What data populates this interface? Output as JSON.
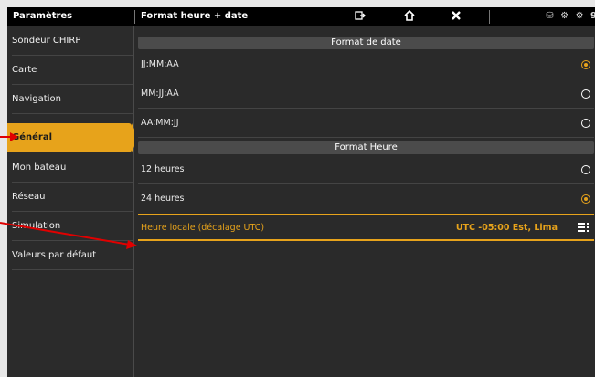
{
  "topbar": {
    "section_title": "Paramètres",
    "page_title": "Format heure + date",
    "icons": [
      "exit-icon",
      "home-icon",
      "close-icon"
    ],
    "status_icons": "⛁ ⚙ ⚙ 9"
  },
  "sidebar": {
    "items": [
      {
        "label": "Sondeur CHIRP"
      },
      {
        "label": "Carte"
      },
      {
        "label": "Navigation"
      },
      {
        "label": "Général",
        "active": true
      },
      {
        "label": "Mon bateau"
      },
      {
        "label": "Réseau"
      },
      {
        "label": "Simulation"
      },
      {
        "label": "Valeurs par défaut"
      }
    ]
  },
  "date_format": {
    "header": "Format de date",
    "options": [
      {
        "label": "JJ:MM:AA",
        "selected": true
      },
      {
        "label": "MM:JJ:AA",
        "selected": false
      },
      {
        "label": "AA:MM:JJ",
        "selected": false
      }
    ]
  },
  "time_format": {
    "header": "Format Heure",
    "options": [
      {
        "label": "12 heures",
        "selected": false
      },
      {
        "label": "24 heures",
        "selected": true
      }
    ]
  },
  "timezone": {
    "label": "Heure locale (décalage UTC)",
    "value": "UTC -05:00 Est, Lima"
  },
  "colors": {
    "accent": "#e7a31b",
    "background": "#2a2a2a",
    "header_bar": "#000000",
    "annotation_arrow": "#e00000"
  }
}
